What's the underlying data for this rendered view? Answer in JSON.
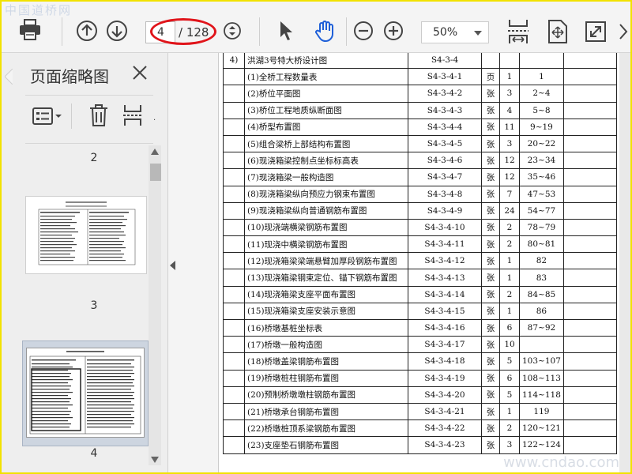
{
  "watermark": {
    "top_left": "中国道桥网",
    "bottom_right": "www.cndao.com"
  },
  "toolbar": {
    "page_current": "4",
    "page_total": "/ 128",
    "zoom": "50%",
    "icons": [
      "printer-icon",
      "arrow-up-icon",
      "arrow-down-icon",
      "page-stepper-icon",
      "select-pointer-icon",
      "hand-icon",
      "zoom-out-icon",
      "zoom-in-icon",
      "fit-width-icon",
      "fit-page-icon",
      "fullscreen-icon",
      "more-icon"
    ],
    "colors": {
      "annotation_ellipse": "#e0141a",
      "hand_icon": "#1e5fd8",
      "frame": "#f2e200"
    }
  },
  "sidebar": {
    "title": "页面缩略图",
    "thumbnails": [
      {
        "label": "2"
      },
      {
        "label": "3"
      },
      {
        "label": "4",
        "selected": true
      }
    ]
  },
  "document": {
    "rows": [
      {
        "no": "4)",
        "name": "洪湖3号特大桥设计图",
        "code": "S4-3-4",
        "unit": "",
        "count": "",
        "pages": ""
      },
      {
        "no": "",
        "name": "(1)全桥工程数量表",
        "code": "S4-3-4-1",
        "unit": "页",
        "count": "1",
        "pages": "1"
      },
      {
        "no": "",
        "name": "(2)桥位平面图",
        "code": "S4-3-4-2",
        "unit": "张",
        "count": "3",
        "pages": "2~4"
      },
      {
        "no": "",
        "name": "(3)桥位工程地质纵断面图",
        "code": "S4-3-4-3",
        "unit": "张",
        "count": "4",
        "pages": "5~8"
      },
      {
        "no": "",
        "name": "(4)桥型布置图",
        "code": "S4-3-4-4",
        "unit": "张",
        "count": "11",
        "pages": "9~19"
      },
      {
        "no": "",
        "name": "(5)组合梁桥上部结构布置图",
        "code": "S4-3-4-5",
        "unit": "张",
        "count": "3",
        "pages": "20~22"
      },
      {
        "no": "",
        "name": "(6)现浇箱梁控制点坐标标高表",
        "code": "S4-3-4-6",
        "unit": "张",
        "count": "12",
        "pages": "23~34"
      },
      {
        "no": "",
        "name": "(7)现浇箱梁一般构造图",
        "code": "S4-3-4-7",
        "unit": "张",
        "count": "12",
        "pages": "35~46"
      },
      {
        "no": "",
        "name": "(8)现浇箱梁纵向预应力钢束布置图",
        "code": "S4-3-4-8",
        "unit": "张",
        "count": "7",
        "pages": "47~53"
      },
      {
        "no": "",
        "name": "(9)现浇箱梁纵向普通钢筋布置图",
        "code": "S4-3-4-9",
        "unit": "张",
        "count": "24",
        "pages": "54~77"
      },
      {
        "no": "",
        "name": "(10)现浇端横梁钢筋布置图",
        "code": "S4-3-4-10",
        "unit": "张",
        "count": "2",
        "pages": "78~79"
      },
      {
        "no": "",
        "name": "(11)现浇中横梁钢筋布置图",
        "code": "S4-3-4-11",
        "unit": "张",
        "count": "2",
        "pages": "80~81"
      },
      {
        "no": "",
        "name": "(12)现浇箱梁梁端悬臂加厚段钢筋布置图",
        "code": "S4-3-4-12",
        "unit": "张",
        "count": "1",
        "pages": "82"
      },
      {
        "no": "",
        "name": "(13)现浇箱梁钢束定位、锚下钢筋布置图",
        "code": "S4-3-4-13",
        "unit": "张",
        "count": "1",
        "pages": "83"
      },
      {
        "no": "",
        "name": "(14)现浇箱梁支座平面布置图",
        "code": "S4-3-4-14",
        "unit": "张",
        "count": "2",
        "pages": "84~85"
      },
      {
        "no": "",
        "name": "(15)现浇箱梁支座安装示意图",
        "code": "S4-3-4-15",
        "unit": "张",
        "count": "1",
        "pages": "86"
      },
      {
        "no": "",
        "name": "(16)桥墩基桩坐标表",
        "code": "S4-3-4-16",
        "unit": "张",
        "count": "6",
        "pages": "87~92"
      },
      {
        "no": "",
        "name": "(17)桥墩一般构造图",
        "code": "S4-3-4-17",
        "unit": "张",
        "count": "10",
        "pages": ""
      },
      {
        "no": "",
        "name": "(18)桥墩盖梁钢筋布置图",
        "code": "S4-3-4-18",
        "unit": "张",
        "count": "5",
        "pages": "103~107"
      },
      {
        "no": "",
        "name": "(19)桥墩桩柱钢筋布置图",
        "code": "S4-3-4-19",
        "unit": "张",
        "count": "6",
        "pages": "108~113"
      },
      {
        "no": "",
        "name": "(20)预制桥墩墩柱钢筋布置图",
        "code": "S4-3-4-20",
        "unit": "张",
        "count": "5",
        "pages": "114~118"
      },
      {
        "no": "",
        "name": "(21)桥墩承台钢筋布置图",
        "code": "S4-3-4-21",
        "unit": "张",
        "count": "1",
        "pages": "119"
      },
      {
        "no": "",
        "name": "(22)桥墩桩顶系梁钢筋布置图",
        "code": "S4-3-4-22",
        "unit": "张",
        "count": "2",
        "pages": "120~121"
      },
      {
        "no": "",
        "name": "(23)支座垫石钢筋布置图",
        "code": "S4-3-4-23",
        "unit": "张",
        "count": "3",
        "pages": "122~124"
      }
    ]
  }
}
